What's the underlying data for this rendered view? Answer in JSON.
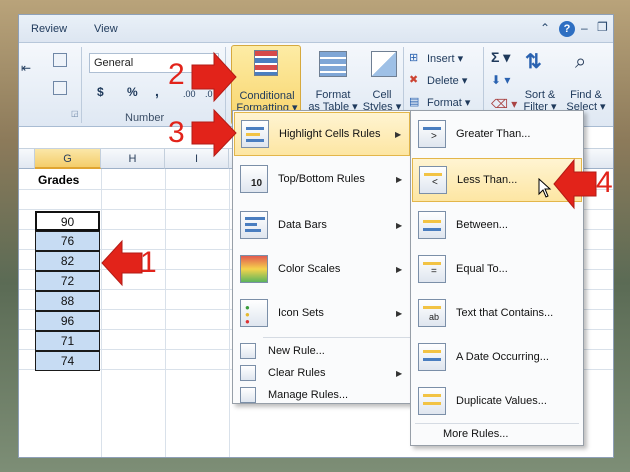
{
  "ribbon": {
    "tabs": [
      "Review",
      "View"
    ],
    "number_format": "General",
    "number_group_label": "Number",
    "number_symbols": [
      "$",
      "%",
      ","
    ],
    "decimal_labels": [
      ".00",
      ".0"
    ],
    "conditional_formatting": [
      "Conditional",
      "Formatting"
    ],
    "format_as_table": [
      "Format",
      "as Table"
    ],
    "cell_styles": [
      "Cell",
      "Styles"
    ],
    "insert": "Insert",
    "delete": "Delete",
    "format": "Format",
    "sort_filter": [
      "Sort &",
      "Filter"
    ],
    "find_select": [
      "Find &",
      "Select"
    ],
    "sigma": "Σ"
  },
  "grid": {
    "columns": [
      "G",
      "H",
      "I"
    ],
    "header": "Grades",
    "values": [
      "90",
      "76",
      "82",
      "72",
      "88",
      "96",
      "71",
      "74"
    ]
  },
  "cf_menu": {
    "items": [
      {
        "label": "Highlight Cells Rules",
        "submenu": true
      },
      {
        "label": "Top/Bottom Rules",
        "submenu": true
      },
      {
        "label": "Data Bars",
        "submenu": true
      },
      {
        "label": "Color Scales",
        "submenu": true
      },
      {
        "label": "Icon Sets",
        "submenu": true
      }
    ],
    "small_items": [
      "New Rule...",
      "Clear Rules",
      "Manage Rules..."
    ],
    "top_bottom_icon_text": "10"
  },
  "submenu": {
    "items": [
      "Greater Than...",
      "Less Than...",
      "Between...",
      "Equal To...",
      "Text that Contains...",
      "A Date Occurring...",
      "Duplicate Values..."
    ],
    "more": "More Rules...",
    "text_icon_label": "ab"
  },
  "annotations": [
    "1",
    "2",
    "3",
    "4"
  ],
  "colors": {
    "accent_red": "#e2231a",
    "highlight": "#fde6a3",
    "cell_fill": "#c7dcf3"
  }
}
